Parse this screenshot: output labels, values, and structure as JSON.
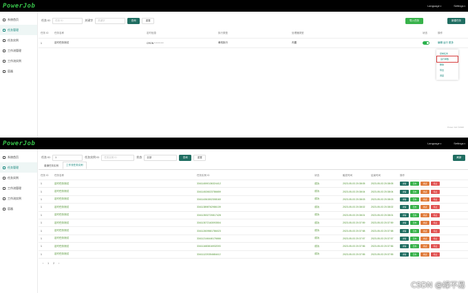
{
  "top": {
    "logo": "PowerJob",
    "language": "Language",
    "settings": "Settings",
    "sidebar": [
      {
        "label": "系统首页",
        "icon": "home-icon"
      },
      {
        "label": "任务管理",
        "icon": "task-icon"
      },
      {
        "label": "任务实例",
        "icon": "instance-icon"
      },
      {
        "label": "工作流管理",
        "icon": "workflow-icon"
      },
      {
        "label": "工作流实例",
        "icon": "workflow-instance-icon"
      },
      {
        "label": "容器",
        "icon": "container-icon"
      }
    ],
    "filter": {
      "id_label": "任务 ID",
      "id_placeholder": "任务 ID",
      "keyword_label": "关键字",
      "keyword_placeholder": "关键字",
      "search": "查询",
      "reset": "重置",
      "import": "导入任务",
      "new": "新建任务"
    },
    "headers": [
      "任务 ID",
      "任务名称",
      "定时信息",
      "执行类型",
      "处理器类型",
      "状态",
      "操作"
    ],
    "row": {
      "id": "1",
      "name": "定时任务测试",
      "timing": "CRON * * * * * *",
      "exec": "单机执行",
      "processor": "内置",
      "actions": "编辑 运行 更多"
    },
    "menu": [
      "复制任务",
      "运行参数",
      "删除",
      "导出",
      "调度"
    ],
    "footer": "Power Job ©2020"
  },
  "bottom": {
    "logo": "PowerJob",
    "language": "Language",
    "settings": "Settings",
    "sidebar": [
      {
        "label": "系统首页",
        "icon": "home-icon"
      },
      {
        "label": "任务管理",
        "icon": "task-icon"
      },
      {
        "label": "任务实例",
        "icon": "instance-icon"
      },
      {
        "label": "工作流管理",
        "icon": "workflow-icon"
      },
      {
        "label": "工作流实例",
        "icon": "workflow-instance-icon"
      },
      {
        "label": "容器",
        "icon": "container-icon"
      }
    ],
    "filter": {
      "id_label": "任务 ID",
      "id_value": "1",
      "inst_label": "任务实例 ID",
      "inst_placeholder": "任务实例 ID",
      "status_label": "状态",
      "status_value": "全部",
      "search": "查询",
      "reset": "重置",
      "refresh": "刷新"
    },
    "tabs": [
      "普通任务实例",
      "工作流任务实例"
    ],
    "headers": [
      "任务 ID",
      "任务名称",
      "任务实例 ID",
      "状态",
      "触发时间",
      "结束时间",
      "操作"
    ],
    "rows": [
      {
        "id": "1",
        "name": "定时任务测试",
        "inst": "334114590136324412",
        "status": "成功",
        "trigger": "2023-05-03 20:38:05",
        "end": "2023-05-03 20:38:05"
      },
      {
        "id": "1",
        "name": "定时任务测试",
        "inst": "334114526023786659",
        "status": "成功",
        "trigger": "2023-05-03 20:38:04",
        "end": "2023-05-03 20:38:04"
      },
      {
        "id": "1",
        "name": "定时任务测试",
        "inst": "334114361502308160",
        "status": "成功",
        "trigger": "2023-05-03 20:38:03",
        "end": "2023-05-03 20:38:03"
      },
      {
        "id": "1",
        "name": "定时任务测试",
        "inst": "334113898762986139",
        "status": "成功",
        "trigger": "2023-05-03 20:38:02",
        "end": "2023-05-03 20:38:02"
      },
      {
        "id": "1",
        "name": "定时任务测试",
        "inst": "334113532720817428",
        "status": "成功",
        "trigger": "2023-05-03 20:38:01",
        "end": "2023-05-03 20:38:01"
      },
      {
        "id": "1",
        "name": "定时任务测试",
        "inst": "334113072163093504",
        "status": "成功",
        "trigger": "2023-05-03 20:37:59",
        "end": "2023-05-03 20:37:59"
      },
      {
        "id": "1",
        "name": "定时任务测试",
        "inst": "334112609581786023",
        "status": "成功",
        "trigger": "2023-05-03 20:37:58",
        "end": "2023-05-03 20:37:58"
      },
      {
        "id": "1",
        "name": "定时任务测试",
        "inst": "334112146446176666",
        "status": "成功",
        "trigger": "2023-05-03 20:37:57",
        "end": "2023-05-03 20:37:57"
      },
      {
        "id": "1",
        "name": "定时任务测试",
        "inst": "334111683816932093",
        "status": "成功",
        "trigger": "2023-05-03 20:37:56",
        "end": "2023-05-03 20:37:56"
      },
      {
        "id": "1",
        "name": "定时任务测试",
        "inst": "334111220354684412",
        "status": "成功",
        "trigger": "2023-05-03 20:37:55",
        "end": "2023-05-03 20:37:55"
      }
    ],
    "row_actions": [
      "详情",
      "日志",
      "重试",
      "停止"
    ],
    "pager": [
      "‹",
      "1",
      "2",
      "›"
    ],
    "watermark": "CSDN @绿不易"
  }
}
